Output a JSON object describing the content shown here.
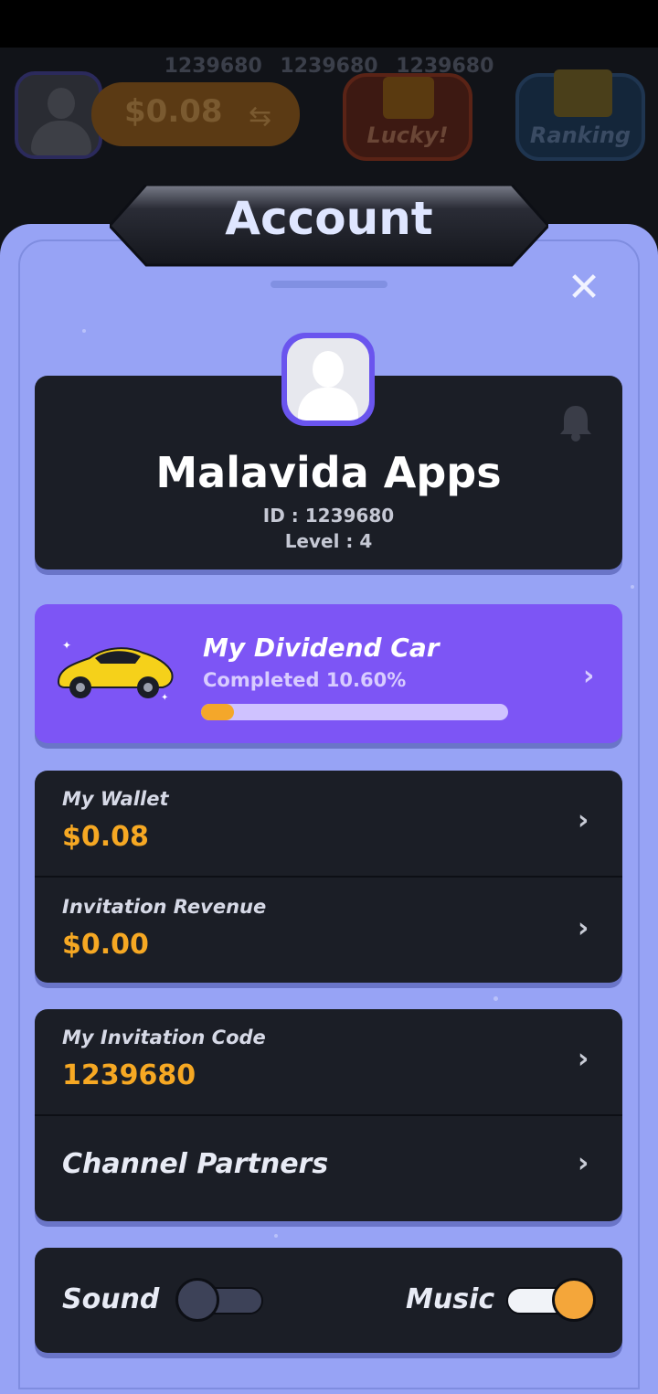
{
  "background": {
    "ticker": [
      "1239680",
      "1239680",
      "1239680"
    ],
    "balance": "$0.08",
    "lucky_label": "Lucky!",
    "ranking_label": "Ranking"
  },
  "dialog": {
    "title": "Account",
    "close_icon": "close-icon"
  },
  "profile": {
    "name": "Malavida Apps",
    "id_text": "ID : 1239680",
    "level_text": "Level : 4",
    "notification_icon": "bell-icon"
  },
  "dividend": {
    "title": "My Dividend Car",
    "subtitle": "Completed 10.60%",
    "progress": 0.106,
    "accent": "#7d55f5"
  },
  "wallet": {
    "label": "My Wallet",
    "value": "$0.08"
  },
  "invitation_revenue": {
    "label": "Invitation Revenue",
    "value": "$0.00"
  },
  "invitation_code": {
    "label": "My Invitation Code",
    "value": "1239680"
  },
  "channel": {
    "label": "Channel Partners"
  },
  "settings": {
    "sound_label": "Sound",
    "sound_on": false,
    "music_label": "Music",
    "music_on": true
  },
  "colors": {
    "panel": "#97a3f5",
    "card": "#1b1e26",
    "value_orange": "#f6a823"
  }
}
